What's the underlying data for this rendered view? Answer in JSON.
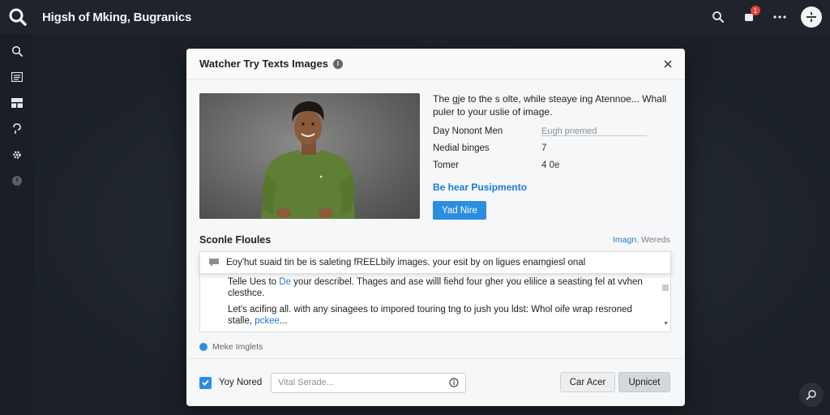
{
  "app": {
    "title": "Higsh of Mking, Bugranics",
    "notification_count": "1"
  },
  "topbar_icons": [
    "search-icon",
    "notification-icon",
    "more-icon",
    "avatar"
  ],
  "sidebar": {
    "items": [
      "search-icon",
      "list-icon",
      "layout-icon",
      "hook-icon",
      "gear-icon",
      "clock-icon"
    ]
  },
  "modal": {
    "title": "Watcher Try Texts Images",
    "description": "The gje to the s olte, while steaye ing Atennoe... Whall puler to your uslie of image.",
    "fields": [
      {
        "label": "Day Nonont Men",
        "value": "Eugh pnemed",
        "is_input": true
      },
      {
        "label": "Nedial binges",
        "value": "7"
      },
      {
        "label": "Tomer",
        "value": "4 0e"
      }
    ],
    "details_link": "Be hear Pusipmento",
    "primary_button": "Yad Nire",
    "section_title": "Sconle Floules",
    "section_link_accent": "Imagn.",
    "section_link_rest": " Wereds",
    "suggestion": "Eoy'hut suaid tin be is saleting fREELbily images. your esit by on ligues enamgiesl onal",
    "textarea": {
      "line1_a": "Telle Ues to ",
      "line1_accent": "De",
      "line1_b": " your describel. Thages and ase willl fiehd four gher you elilice a seasting fel at vvhen clesthce.",
      "line2_a": "Let's acifing all. with any sinagees to impored touring tng to jush you ldst: Whol oife wrap resroned stalle, ",
      "line2_accent": "pckee",
      "line2_b": "..."
    },
    "radio_label": "Meke Imglets",
    "checkbox_label": "Yoy Nored",
    "footer_input_placeholder": "Vital Serade...",
    "cancel_button": "Car Acer",
    "upload_button": "Upnicet"
  },
  "colors": {
    "accent": "#2b8de0",
    "topbar_bg": "#1f242c",
    "badge": "#e0433a",
    "shirt": "#5e7f34"
  }
}
